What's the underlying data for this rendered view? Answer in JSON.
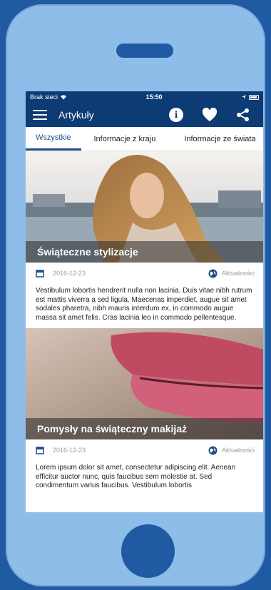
{
  "status": {
    "carrier": "Brak sieci",
    "time": "15:50"
  },
  "nav": {
    "title": "Artykuły"
  },
  "tabs": [
    "Wszystkie",
    "Informacje z kraju",
    "Informacje ze świata"
  ],
  "articles": [
    {
      "title": "Świąteczne stylizacje",
      "date": "2016-12-23",
      "category": "Aktualności",
      "excerpt": "Vestibulum lobortis hendrerit nulla non lacinia. Duis vitae nibh rutrum est mattis viverra a sed ligula. Maecenas imperdiet, augue sit amet sodales pharetra, nibh mauris interdum ex, in commodo augue massa sit amet felis. Cras lacinia leo in commodo pellentesque."
    },
    {
      "title": "Pomysły na świąteczny makijaż",
      "date": "2016-12-23",
      "category": "Aktualności",
      "excerpt": "Lorem ipsum dolor sit amet, consectetur adipiscing elit. Aenean efficitur auctor nunc, quis faucibus sem molestie at. Sed condimentum varius faucibus. Vestibulum lobortis"
    }
  ],
  "colors": {
    "background": "#1f5aa3",
    "phone": "#8fbde9",
    "navbar": "#0d3b73",
    "accent": "#1f4f8a"
  }
}
